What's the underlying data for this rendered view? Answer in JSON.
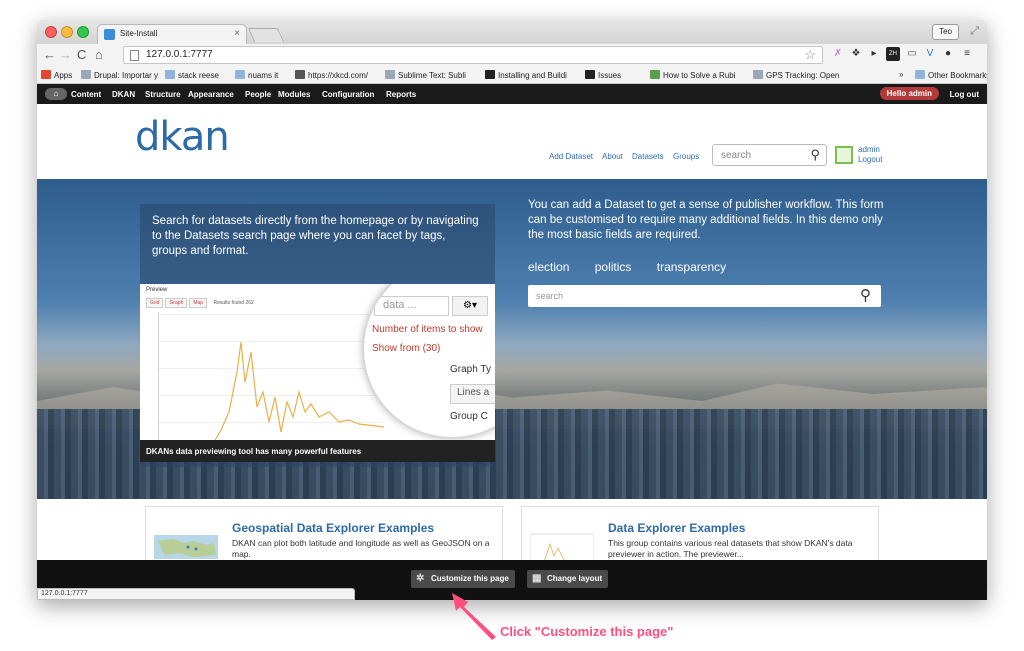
{
  "browser": {
    "tab_title": "Site-Install",
    "tab_close": "×",
    "user_chip": "Teo",
    "url": "127.0.0.1:7777",
    "status_url": "127.0.0.1:7777"
  },
  "bookmarks": [
    {
      "label": "Apps",
      "color": "#e2462f"
    },
    {
      "label": "Drupal: Importar y",
      "color": "#9aa7b5"
    },
    {
      "label": "stack reese",
      "color": "#8fb3d9"
    },
    {
      "label": "nuams it",
      "color": "#8fb3d9"
    },
    {
      "label": "https://xkcd.com/",
      "color": "#555555"
    },
    {
      "label": "Sublime Text: Subli",
      "color": "#9aa7b5"
    },
    {
      "label": "Installing and Buildi",
      "color": "#222222"
    },
    {
      "label": "Issues",
      "color": "#222222"
    },
    {
      "label": "How to Solve a Rubi",
      "color": "#5aa04a"
    },
    {
      "label": "GPS Tracking: Open",
      "color": "#9aa7b5"
    },
    {
      "label": "»",
      "color": "#ffffff"
    },
    {
      "label": "Other Bookmarks",
      "color": "#8fb3d9"
    }
  ],
  "adminbar": {
    "items": [
      "Content",
      "DKAN",
      "Structure",
      "Appearance",
      "People",
      "Modules",
      "Configuration",
      "Reports"
    ],
    "hello": "Hello admin",
    "logout": "Log out"
  },
  "site": {
    "logo": "dkan",
    "nav": [
      "Add Dataset",
      "About",
      "Datasets",
      "Groups"
    ],
    "search_placeholder": "search",
    "user_name": "admin",
    "user_logout": "Logout"
  },
  "hero": {
    "left_text": "Search for datasets directly from the homepage or by navigating to the Datasets search page where you can facet by tags, groups and format.",
    "preview_title": "Preview",
    "preview_buttons": [
      "Grid",
      "Graph",
      "Map"
    ],
    "preview_results": "Results found 262",
    "mag_input": "data ...",
    "mag_gear": "⚙▾",
    "mag_items": [
      "Number of items to show",
      "Show from (30)"
    ],
    "mag_labels": [
      "Graph Ty",
      "Group C"
    ],
    "mag_select": "Lines a",
    "caption": "DKANs data previewing tool has many powerful features",
    "right_text": "You can add a Dataset to get a sense of publisher workflow. This form can be customised to require many additional fields. In this demo only the most basic fields are required.",
    "tags": [
      "election",
      "politics",
      "transparency"
    ],
    "search_placeholder": "search"
  },
  "cards": [
    {
      "title": "Geospatial Data Explorer Examples",
      "desc": "DKAN can plot both latitude and longitude as well as GeoJSON on a map."
    },
    {
      "title": "Data Explorer Examples",
      "desc": "This group contains various real datasets that show DKAN's data previewer in action. The previewer..."
    }
  ],
  "bottombar": {
    "customize": "Customize this page",
    "change_layout": "Change layout"
  },
  "annotation": {
    "callout": "Click \"Customize this page\"",
    "color": "#ff4f7f"
  }
}
